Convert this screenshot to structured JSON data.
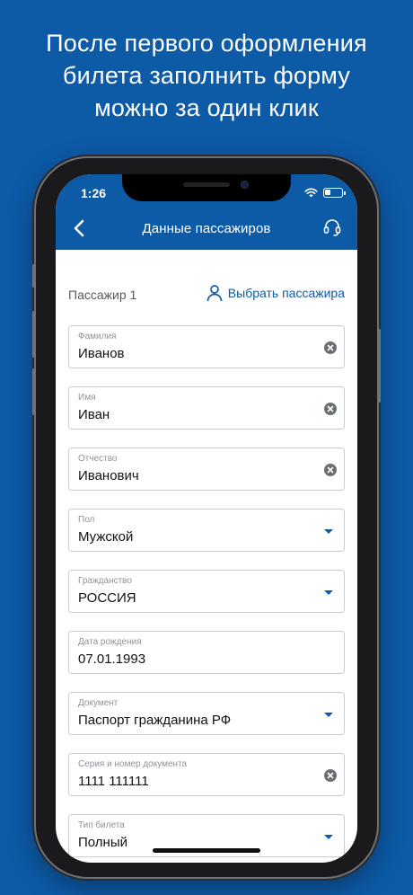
{
  "promo": {
    "line1": "После первого оформления",
    "line2": "билета заполнить форму",
    "line3": "можно за один клик"
  },
  "status": {
    "time": "1:26"
  },
  "header": {
    "title": "Данные пассажиров"
  },
  "passenger": {
    "label": "Пассажир 1",
    "choose_label": "Выбрать пассажира"
  },
  "fields": [
    {
      "label": "Фамилия",
      "value": "Иванов",
      "control": "clear"
    },
    {
      "label": "Имя",
      "value": "Иван",
      "control": "clear"
    },
    {
      "label": "Отчество",
      "value": "Иванович",
      "control": "clear"
    },
    {
      "label": "Пол",
      "value": "Мужской",
      "control": "dropdown"
    },
    {
      "label": "Гражданство",
      "value": "РОССИЯ",
      "control": "dropdown"
    },
    {
      "label": "Дата рождения",
      "value": "07.01.1993",
      "control": "none"
    },
    {
      "label": "Документ",
      "value": "Паспорт гражданина РФ",
      "control": "dropdown"
    },
    {
      "label": "Серия и номер документа",
      "value": "1111 111111",
      "control": "clear"
    },
    {
      "label": "Тип билета",
      "value": "Полный",
      "control": "dropdown"
    }
  ],
  "colors": {
    "brand": "#0d5aa7",
    "border": "#c9ccd1",
    "label": "#8e9297"
  }
}
